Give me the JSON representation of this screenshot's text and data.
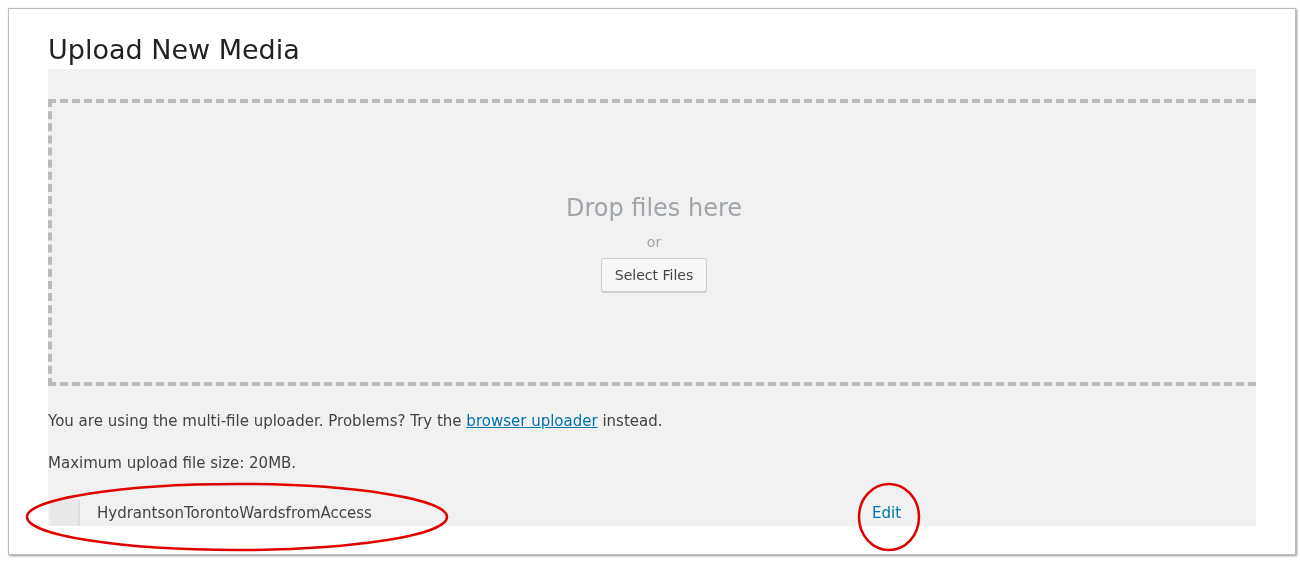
{
  "title": "Upload New Media",
  "dropzone": {
    "heading": "Drop files here",
    "separator": "or",
    "button": "Select Files"
  },
  "notice": {
    "before": "You are using the multi-file uploader. Problems? Try the ",
    "link": "browser uploader",
    "after": " instead."
  },
  "max_size": "Maximum upload file size: 20MB.",
  "files": [
    {
      "name": "HydrantsonTorontoWardsfromAccess",
      "action": "Edit"
    }
  ]
}
